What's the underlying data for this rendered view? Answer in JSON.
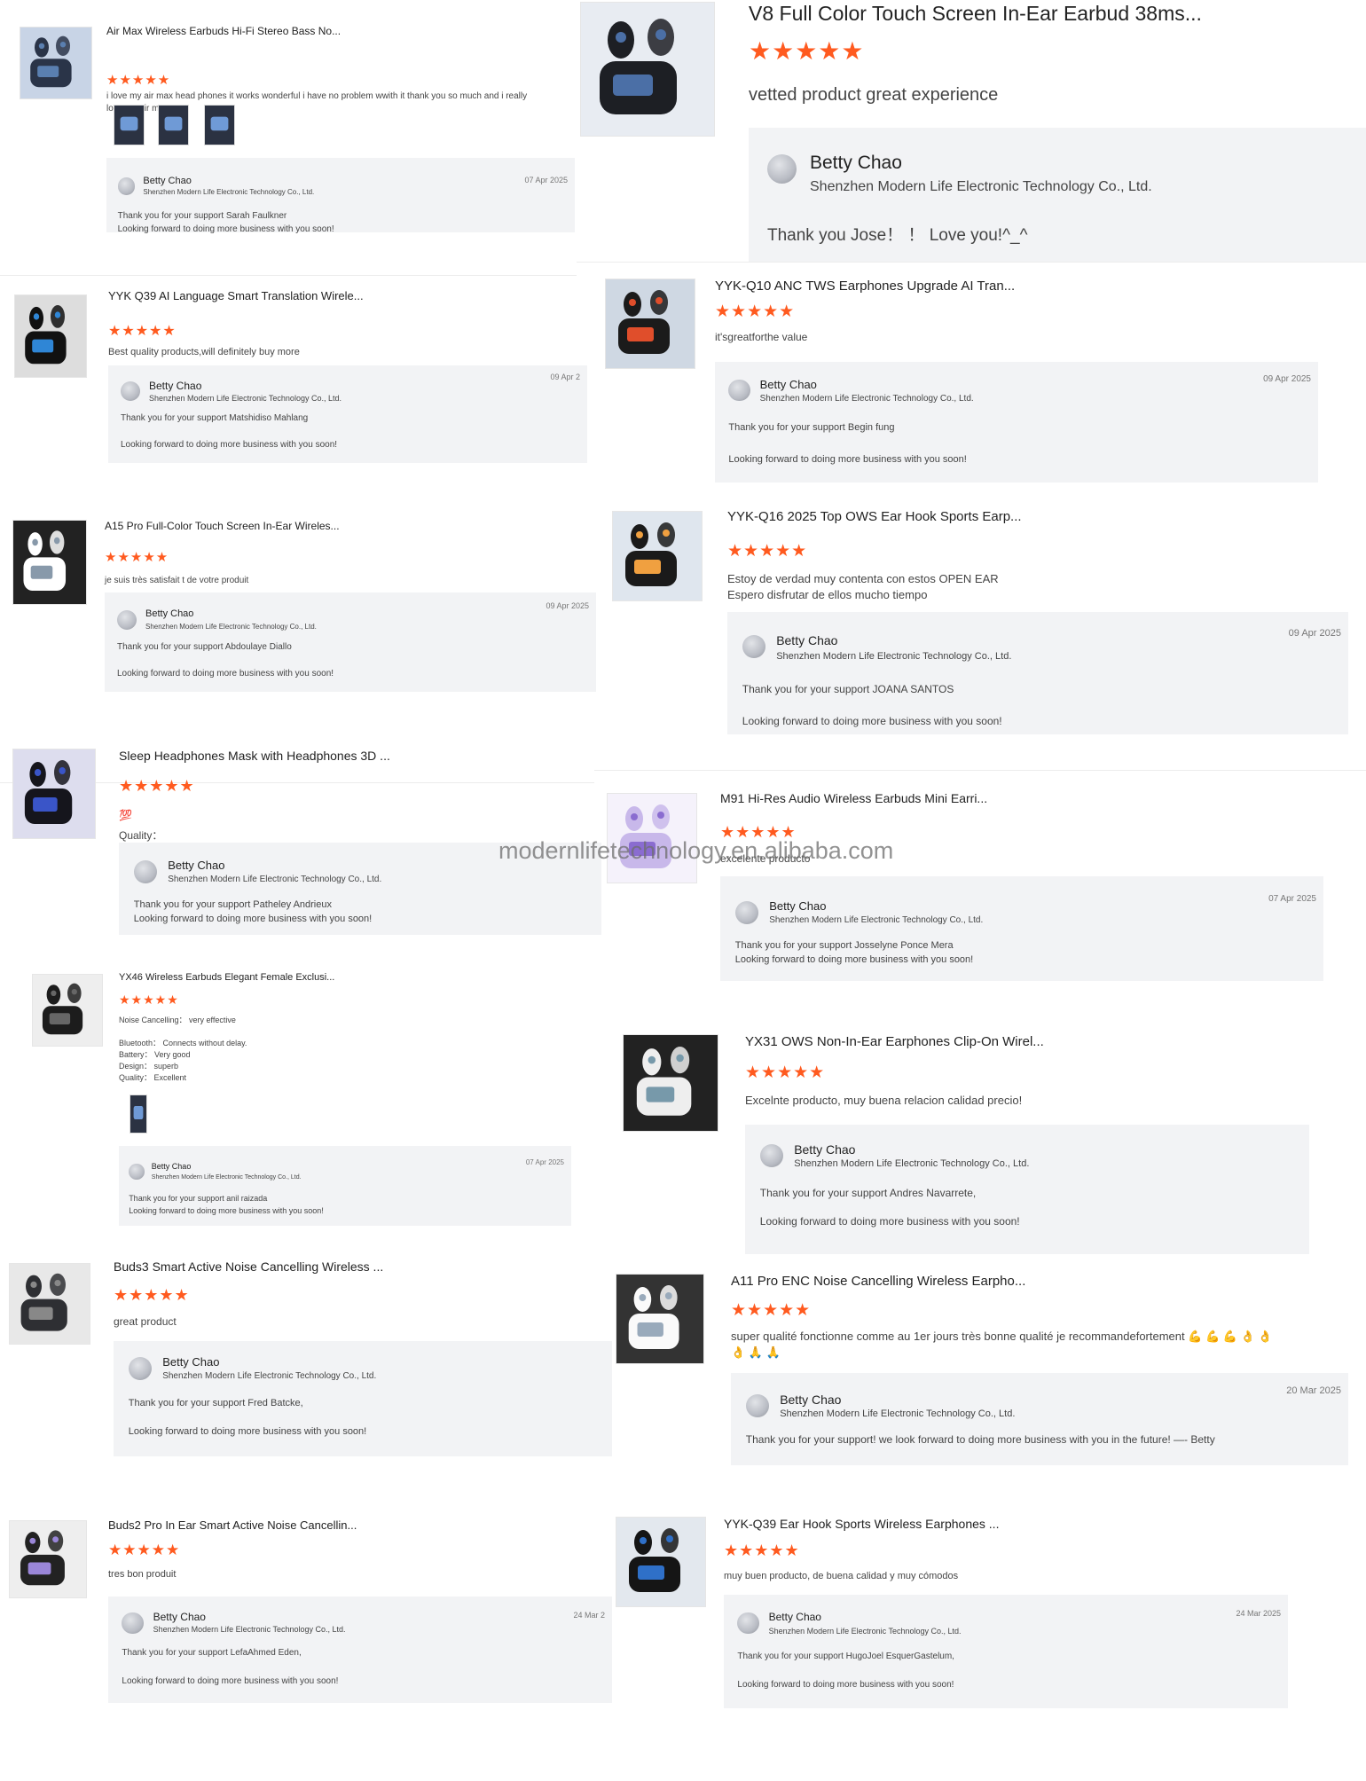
{
  "seller": "Betty Chao",
  "company": "Shenzhen Modern Life Electronic Technology Co., Ltd.",
  "watermark": "modernlifetechnology.en.alibaba.com",
  "stars": "★★★★★",
  "reviews": [
    {
      "title": "Air Max Wireless Earbuds Hi-Fi Stereo Bass No...",
      "lines": [
        "i love my air max head phones it works wonderful i have no problem wwith it thank you so much and i really",
        "love my air max"
      ],
      "date": "07 Apr 2025",
      "msg": [
        "Thank you for your support Sarah Faulkner",
        "Looking forward to doing more business with you soon!"
      ]
    },
    {
      "title": "V8 Full Color Touch Screen In-Ear Earbud 38ms...",
      "lines": [
        "vetted product great experience"
      ],
      "date": "",
      "msg": [
        "Thank you Jose！ ！ Love you!^_^"
      ]
    },
    {
      "title": "YYK Q39 AI Language Smart Translation Wirele...",
      "lines": [
        "Best quality products,will definitely buy more"
      ],
      "date": "09 Apr 2",
      "msg": [
        "Thank you for your support  Matshidiso Mahlang",
        "Looking forward to doing more business with you soon!"
      ]
    },
    {
      "title": "YYK-Q10 ANC TWS Earphones Upgrade AI Tran...",
      "lines": [
        "it'sgreatforthe value"
      ],
      "date": "09 Apr 2025",
      "msg": [
        "Thank you for your support  Begin fung",
        "Looking forward to doing more business with you soon!"
      ]
    },
    {
      "title": "A15 Pro Full-Color Touch Screen In-Ear Wireles...",
      "lines": [
        "je suis très satisfait t de votre produit"
      ],
      "date": "09 Apr 2025",
      "msg": [
        "Thank you for your support  Abdoulaye Diallo",
        "Looking forward to doing more business with you soon!"
      ]
    },
    {
      "title": "YYK-Q16 2025 Top OWS Ear Hook Sports Earp...",
      "lines": [
        "Estoy de verdad muy contenta con estos OPEN EAR",
        "Espero disfrutar de ellos mucho tiempo"
      ],
      "date": "09 Apr 2025",
      "msg": [
        "Thank you for your support  JOANA SANTOS",
        "Looking forward to doing more business with you soon!"
      ]
    },
    {
      "title": "Sleep Headphones Mask with Headphones 3D ...",
      "emoji": "💯",
      "lines": [
        "Quality："
      ],
      "date": "",
      "msg": [
        "Thank you for your support Patheley Andrieux",
        "Looking forward to doing more business with you soon!"
      ]
    },
    {
      "title": "M91 Hi-Res Audio Wireless Earbuds Mini Earri...",
      "lines": [
        "excelente producto"
      ],
      "date": "07 Apr 2025",
      "msg": [
        "Thank you for your support Josselyne Ponce Mera",
        "Looking forward to doing more business with you soon!"
      ]
    },
    {
      "title": "YX46 Wireless Earbuds Elegant Female Exclusi...",
      "lines": [
        "Noise Cancelling：  very effective",
        "",
        "Bluetooth：  Connects without delay.",
        "Battery：  Very good",
        "Design：  superb",
        "Quality：  Excellent"
      ],
      "date": "07 Apr 2025",
      "msg": [
        "Thank you for your support anil raizada",
        "Looking forward to doing more business with you soon!"
      ]
    },
    {
      "title": "YX31 OWS Non-In-Ear Earphones Clip-On Wirel...",
      "lines": [
        "Excelnte producto, muy buena relacion calidad precio!"
      ],
      "date": "",
      "msg": [
        "Thank you for your support Andres Navarrete,",
        "Looking forward to doing more business with you soon!"
      ]
    },
    {
      "title": "Buds3 Smart Active Noise Cancelling Wireless ...",
      "lines": [
        "great product"
      ],
      "date": "",
      "msg": [
        "Thank you for your support Fred Batcke,",
        "Looking forward to doing more business with you soon!"
      ]
    },
    {
      "title": "A11 Pro ENC Noise Cancelling Wireless Earpho...",
      "lines": [
        "super qualité fonctionne comme au 1er jours très bonne qualité je recommandefortement 💪 💪 💪 👌 👌",
        "👌 🙏 🙏"
      ],
      "date": "20 Mar 2025",
      "msg": [
        "Thank you for your support! we look forward to doing more business with you in the future!  —- Betty"
      ]
    },
    {
      "title": "Buds2 Pro In Ear Smart Active Noise Cancellin...",
      "lines": [
        "tres bon produit"
      ],
      "date": "24 Mar 2",
      "msg": [
        "Thank you for your support LefaAhmed Eden,",
        "Looking forward to doing more business with you soon!"
      ]
    },
    {
      "title": "YYK-Q39 Ear Hook Sports Wireless Earphones ...",
      "lines": [
        "muy buen producto, de buena calidad y muy cómodos"
      ],
      "date": "24 Mar 2025",
      "msg": [
        "Thank you for your support HugoJoel EsquerGastelum,",
        "Looking forward to doing more business with you soon!"
      ]
    }
  ]
}
